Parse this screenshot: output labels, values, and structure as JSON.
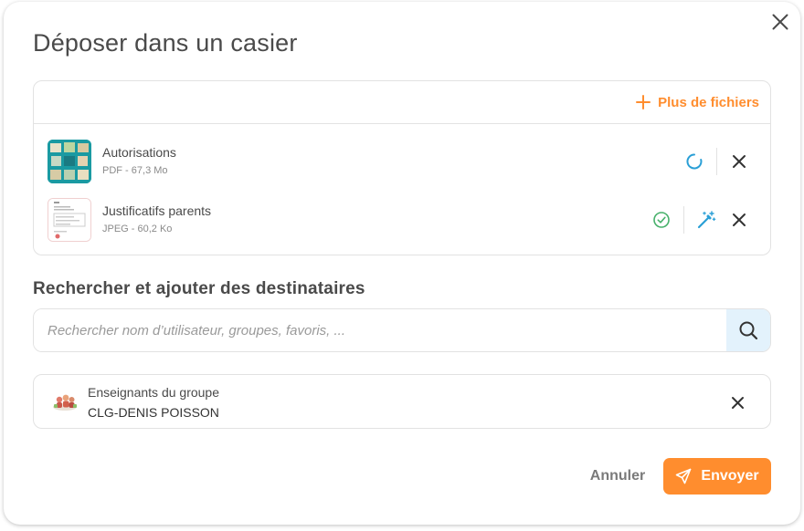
{
  "dialog": {
    "title": "Déposer dans un casier",
    "close_icon": "close-icon"
  },
  "files": {
    "add_more_label": "Plus de fichiers",
    "items": [
      {
        "name": "Autorisations",
        "meta": "PDF - 67,3 Mo",
        "status": "uploading",
        "status_icon": "loading-spinner-icon"
      },
      {
        "name": "Justificatifs parents",
        "meta": "JPEG - 60,2 Ko",
        "status": "done",
        "status_icon": "check-circle-icon",
        "edit_icon": "magic-wand-icon"
      }
    ]
  },
  "recipients": {
    "section_title": "Rechercher et ajouter des destinataires",
    "search_placeholder": "Rechercher nom d’utilisateur, groupes, favoris, ...",
    "search_value": "",
    "selected": [
      {
        "line1": "Enseignants du groupe",
        "line2": "CLG-DENIS POISSON"
      }
    ]
  },
  "footer": {
    "cancel_label": "Annuler",
    "send_label": "Envoyer"
  },
  "colors": {
    "accent": "#ff8d2e",
    "spinner": "#2a9fd6",
    "success": "#46b06a",
    "search_bg": "#e3f2fc"
  }
}
